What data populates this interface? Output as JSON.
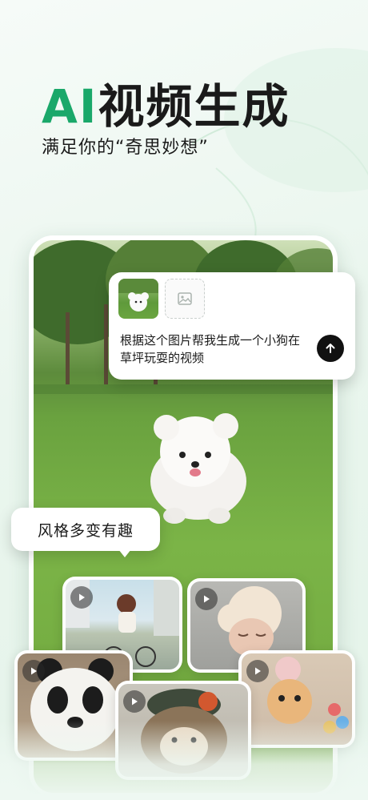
{
  "hero": {
    "title_ai": "AI",
    "title_rest": "视频生成",
    "subtitle": "满足你的“奇思妙想”"
  },
  "prompt_card": {
    "text": "根据这个图片帮我生成一个小狗在草坪玩耍的视频",
    "send_icon": "arrow-up-icon",
    "add_image_icon": "image-placeholder-icon"
  },
  "style_tag": {
    "label": "风格多变有趣"
  },
  "samples": [
    {
      "name": "girl-cycling",
      "icon": "play-icon"
    },
    {
      "name": "clay-girl",
      "icon": "play-icon"
    },
    {
      "name": "panda",
      "icon": "play-icon"
    },
    {
      "name": "hedgehog",
      "icon": "play-icon"
    },
    {
      "name": "cat-in-costume",
      "icon": "play-icon"
    }
  ],
  "colors": {
    "accent": "#1aa86a",
    "text": "#1a1a1a",
    "send_button": "#111111"
  }
}
